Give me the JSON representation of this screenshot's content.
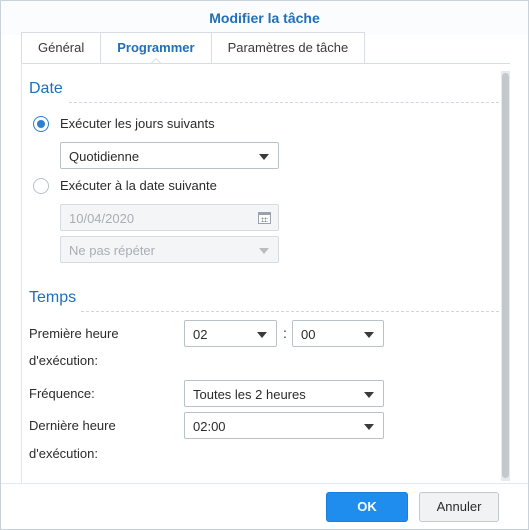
{
  "dialog": {
    "title": "Modifier la tâche"
  },
  "tabs": [
    {
      "label": "Général",
      "active": false
    },
    {
      "label": "Programmer",
      "active": true
    },
    {
      "label": "Paramètres de tâche",
      "active": false
    }
  ],
  "date_section": {
    "title": "Date",
    "option_daily": {
      "label": "Exécuter les jours suivants",
      "checked": true
    },
    "daily_select": {
      "value": "Quotidienne"
    },
    "option_date": {
      "label": "Exécuter à la date suivante",
      "checked": false
    },
    "date_field": {
      "value": "10/04/2020",
      "icon": "calendar-icon"
    },
    "repeat_select": {
      "value": "Ne pas répéter"
    }
  },
  "time_section": {
    "title": "Temps",
    "first_run": {
      "label_line1": "Première heure",
      "label_line2": "d'exécution:",
      "hour": "02",
      "separator": ":",
      "minute": "00"
    },
    "frequency": {
      "label": "Fréquence:",
      "value": "Toutes les 2 heures"
    },
    "last_run": {
      "label_line1": "Dernière heure",
      "label_line2": "d'exécution:",
      "value": "02:00"
    }
  },
  "footer": {
    "ok_label": "OK",
    "cancel_label": "Annuler"
  },
  "colors": {
    "accent": "#1f6fb9",
    "primary_button": "#1f8ded"
  }
}
